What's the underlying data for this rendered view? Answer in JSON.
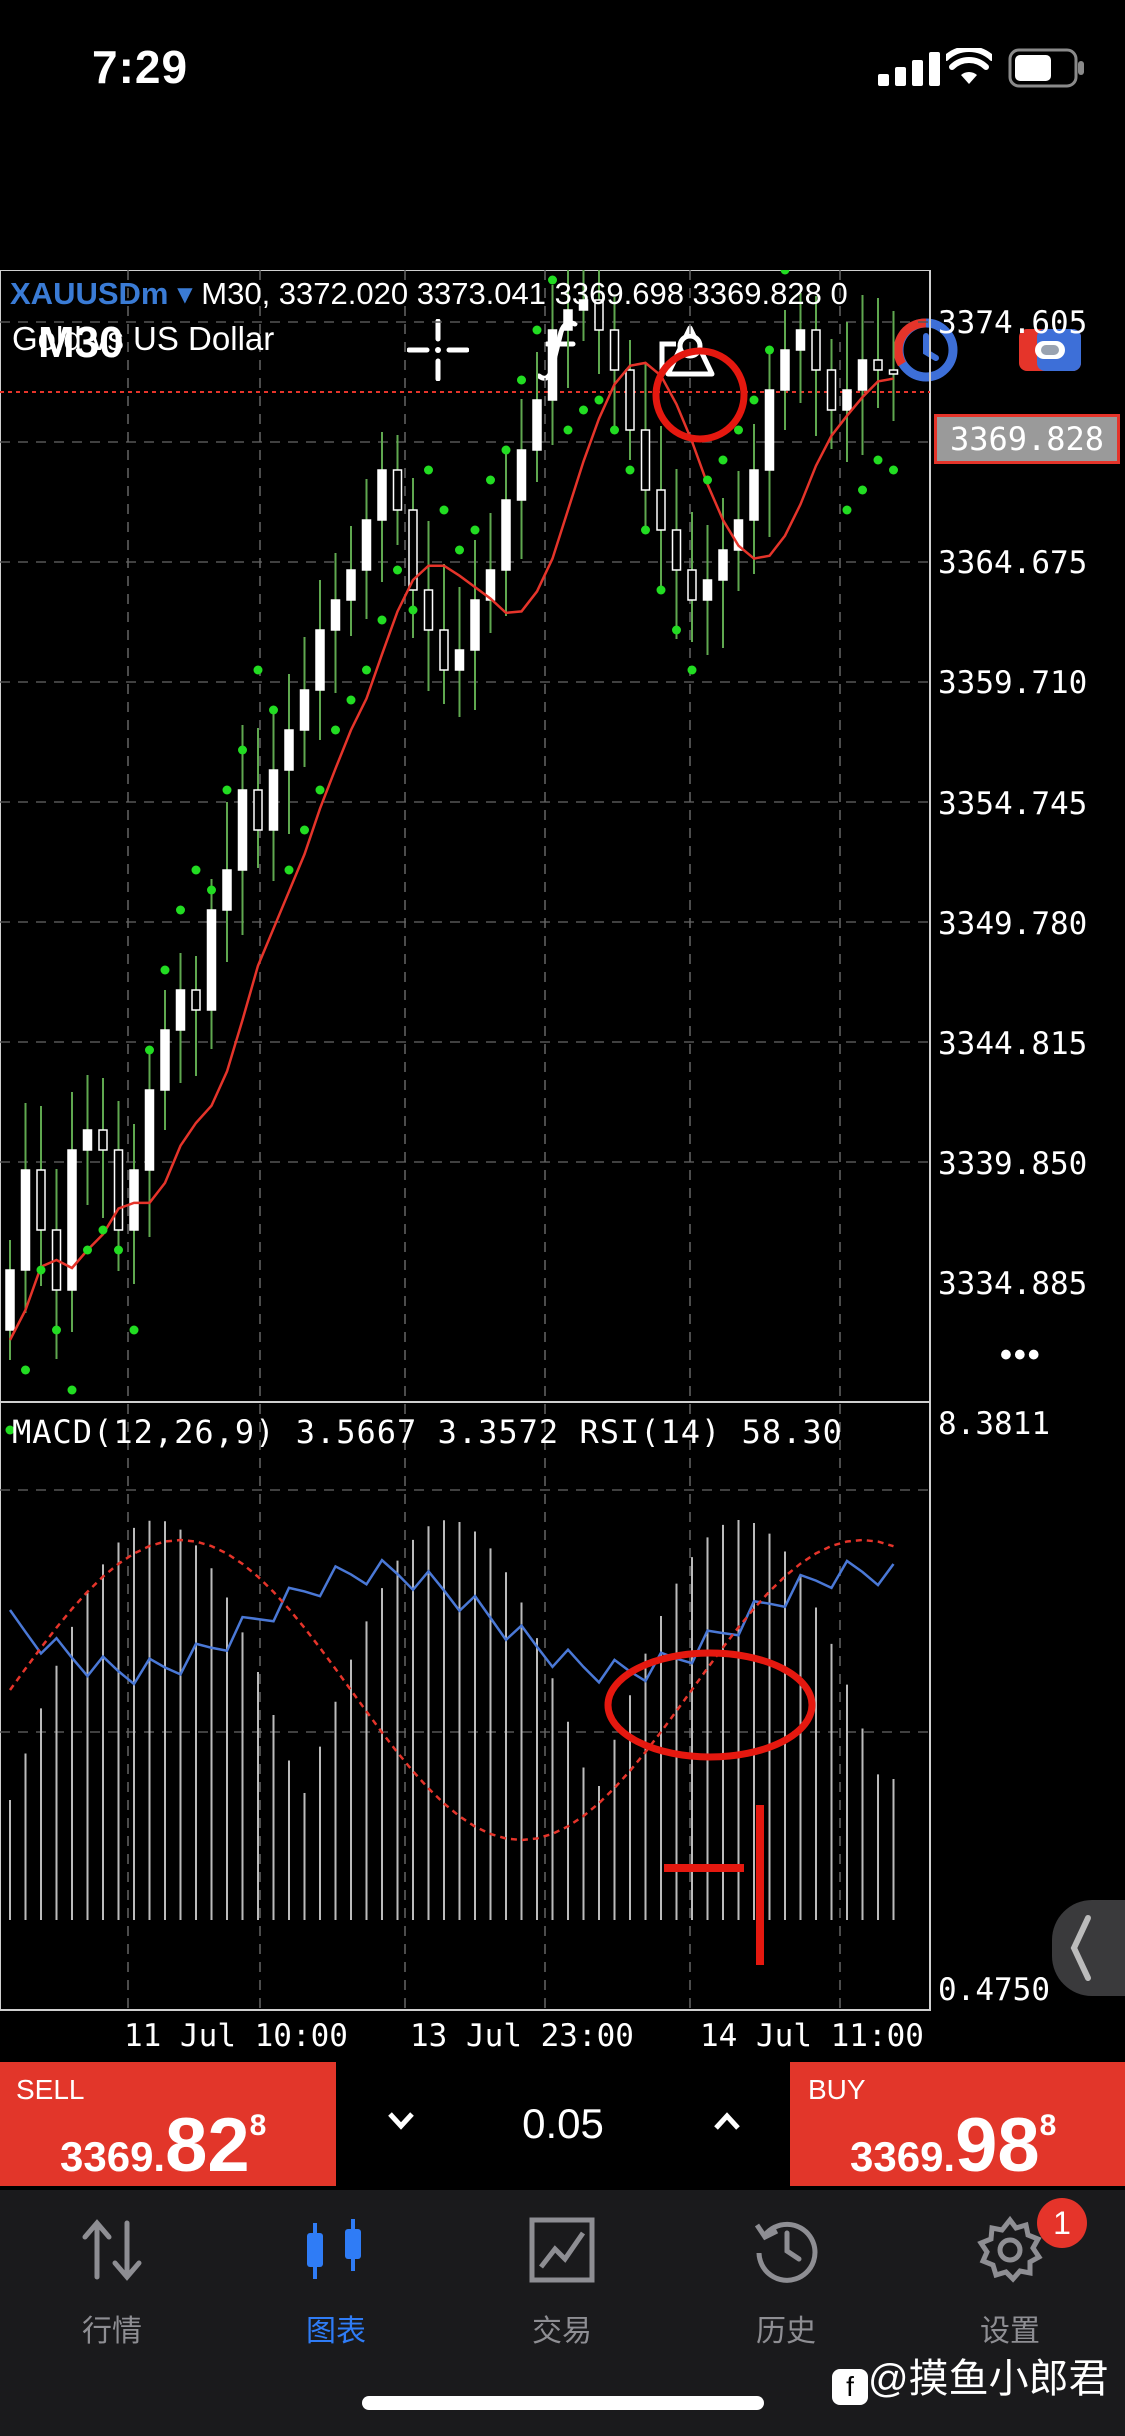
{
  "status_bar": {
    "time": "7:29"
  },
  "toolbar": {
    "timeframe": "M30",
    "icons": [
      "crosshair-icon",
      "function-icon",
      "objects-icon",
      "account-icon",
      "toggle-icon"
    ]
  },
  "chart": {
    "symbol": "XAUUSDm",
    "dropdown_marker": "▾",
    "ohlc_text": "M30, 3372.020 3373.041 3369.698 3369.828 0",
    "description": "Gold vs US Dollar",
    "current_price": "3369.828",
    "price_axis": [
      "3374.605",
      "3369.828",
      "3364.675",
      "3359.710",
      "3354.745",
      "3349.780",
      "3344.815",
      "3339.850",
      "3334.885"
    ],
    "more_menu": "•••",
    "indicator_header": "MACD(12,26,9) 3.5667 3.3572 RSI(14) 58.30",
    "indicator_axis_top": "8.3811",
    "indicator_axis_bottom": "0.4750",
    "time_axis": [
      "11 Jul 10:00",
      "13 Jul 23:00",
      "14 Jul 11:00"
    ],
    "colors": {
      "up_candle": "#ffffff",
      "down_candle": "#ffffff",
      "wick": "#5fa84f",
      "ma_line": "#e5342a",
      "sar_dots": "#22dd22",
      "macd_line": "#4a78d6",
      "signal_line": "#e5342a",
      "annotation": "#e5180f"
    }
  },
  "trade": {
    "sell_label": "SELL",
    "sell_prefix": "3369.",
    "sell_big": "82",
    "sell_sup": "8",
    "volume": "0.05",
    "buy_label": "BUY",
    "buy_prefix": "3369.",
    "buy_big": "98",
    "buy_sup": "8"
  },
  "tabs": [
    {
      "label": "行情",
      "icon": "quotes-icon"
    },
    {
      "label": "图表",
      "icon": "chart-candles-icon",
      "active": true
    },
    {
      "label": "交易",
      "icon": "trade-icon"
    },
    {
      "label": "历史",
      "icon": "history-icon"
    },
    {
      "label": "设置",
      "icon": "settings-icon"
    }
  ],
  "settings_badge": "1",
  "watermark": "@摸鱼小郎君"
}
